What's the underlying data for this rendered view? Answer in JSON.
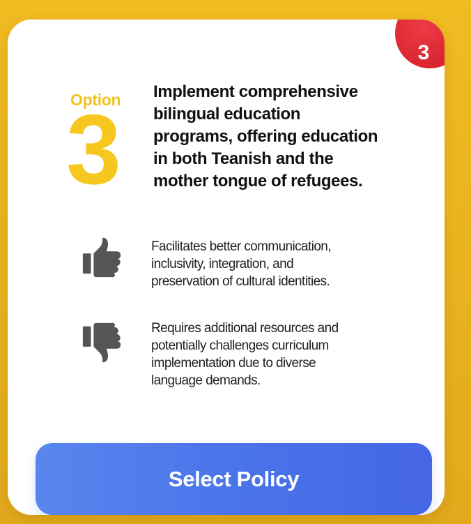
{
  "badge": {
    "number": "3"
  },
  "option": {
    "label": "Option",
    "number": "3"
  },
  "title_lines": [
    "Implement comprehensive",
    "bilingual education",
    "programs, offering education",
    "in both Teanish and the",
    "mother tongue of refugees."
  ],
  "pros": {
    "icon": "thumbs-up-icon",
    "lines": [
      "Facilitates better communication,",
      "inclusivity, integration, and",
      "preservation of cultural identities."
    ]
  },
  "cons": {
    "icon": "thumbs-down-icon",
    "lines": [
      "Requires additional resources and",
      "potentially challenges curriculum",
      "implementation due to diverse",
      "language demands."
    ]
  },
  "button": {
    "label": "Select Policy"
  },
  "colors": {
    "background": "#EDB51F",
    "option_yellow": "#F6C71F",
    "badge_red": "#D8242F",
    "button_blue": "#4A74EA",
    "icon_gray": "#555555"
  }
}
